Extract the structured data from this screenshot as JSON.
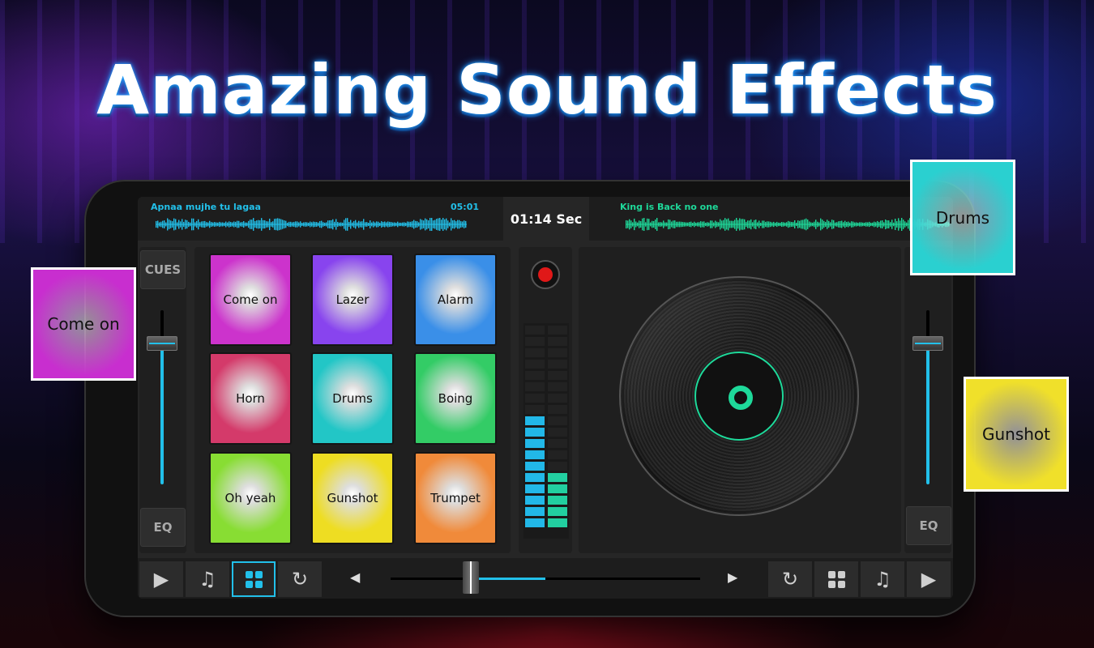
{
  "headline": "Amazing Sound Effects",
  "deck_left": {
    "track_title": "Apnaa mujhe tu lagaa",
    "time": "05:01",
    "wave_color": "#22c0ea"
  },
  "deck_right": {
    "track_title": "King is Back no one",
    "wave_color": "#1ed99a"
  },
  "timer": "01:14 Sec",
  "left_panel": {
    "cues_label": "CUES",
    "eq_label": "EQ",
    "fader_level": 0.85
  },
  "right_panel": {
    "eq_label": "EQ",
    "fader_level": 0.85
  },
  "pads": [
    {
      "label": "Come on",
      "color": "#cc33cc"
    },
    {
      "label": "Lazer",
      "color": "#8844ee"
    },
    {
      "label": "Alarm",
      "color": "#3a8fe8"
    },
    {
      "label": "Horn",
      "color": "#d43a6a"
    },
    {
      "label": "Drums",
      "color": "#22c6c6"
    },
    {
      "label": "Boing",
      "color": "#33cc66"
    },
    {
      "label": "Oh yeah",
      "color": "#88dd33"
    },
    {
      "label": "Gunshot",
      "color": "#eedd22"
    },
    {
      "label": "Trumpet",
      "color": "#f08a3a"
    }
  ],
  "record_button": {
    "color": "#e01818"
  },
  "level_meter": {
    "left_level": 0.55,
    "right_level": 0.25,
    "color": "#22b8e8",
    "right_color": "#22cfa0"
  },
  "turntable": {
    "accent": "#1ed99a"
  },
  "crossfader": {
    "position": 0.26
  },
  "bottom_left_buttons": [
    {
      "name": "play",
      "icon": "play-icon"
    },
    {
      "name": "music",
      "icon": "music-note-icon"
    },
    {
      "name": "pads",
      "icon": "grid-icon",
      "active": true
    },
    {
      "name": "loop",
      "icon": "repeat-icon"
    }
  ],
  "bottom_right_buttons": [
    {
      "name": "loop",
      "icon": "repeat-icon"
    },
    {
      "name": "pads",
      "icon": "grid-icon"
    },
    {
      "name": "music",
      "icon": "music-note-icon"
    },
    {
      "name": "play",
      "icon": "play-icon"
    }
  ],
  "floating_pads": [
    {
      "label": "Come on",
      "color": "#c82ecf"
    },
    {
      "label": "Drums",
      "color": "#2ad0d0"
    },
    {
      "label": "Gunshot",
      "color": "#f0e02a"
    }
  ]
}
